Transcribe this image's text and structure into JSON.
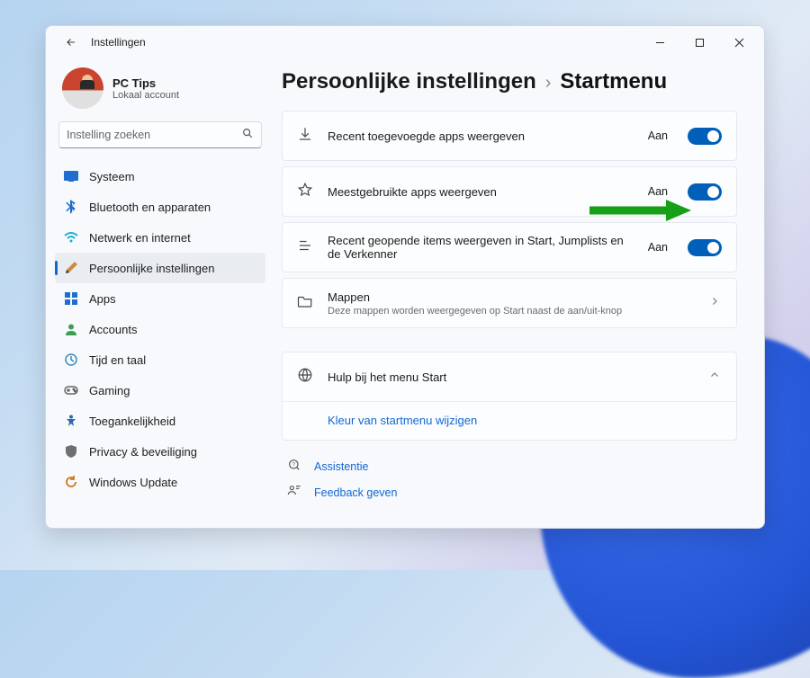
{
  "window": {
    "title": "Instellingen"
  },
  "profile": {
    "name": "PC Tips",
    "sub": "Lokaal account"
  },
  "search": {
    "placeholder": "Instelling zoeken"
  },
  "nav": [
    {
      "key": "systeem",
      "label": "Systeem"
    },
    {
      "key": "bluetooth",
      "label": "Bluetooth en apparaten"
    },
    {
      "key": "netwerk",
      "label": "Netwerk en internet"
    },
    {
      "key": "persoonlijk",
      "label": "Persoonlijke instellingen"
    },
    {
      "key": "apps",
      "label": "Apps"
    },
    {
      "key": "accounts",
      "label": "Accounts"
    },
    {
      "key": "tijd",
      "label": "Tijd en taal"
    },
    {
      "key": "gaming",
      "label": "Gaming"
    },
    {
      "key": "toegankelijkheid",
      "label": "Toegankelijkheid"
    },
    {
      "key": "privacy",
      "label": "Privacy & beveiliging"
    },
    {
      "key": "update",
      "label": "Windows Update"
    }
  ],
  "nav_active": "persoonlijk",
  "breadcrumb": {
    "parent": "Persoonlijke instellingen",
    "current": "Startmenu"
  },
  "toggle_states": {
    "on": "Aan"
  },
  "rows": {
    "recent_apps": {
      "title": "Recent toegevoegde apps weergeven",
      "state": "Aan"
    },
    "most_used": {
      "title": "Meestgebruikte apps weergeven",
      "state": "Aan"
    },
    "recent_items": {
      "title": "Recent geopende items weergeven in Start, Jumplists en de Verkenner",
      "state": "Aan"
    },
    "mappen": {
      "title": "Mappen",
      "sub": "Deze mappen worden weergegeven op Start naast de aan/uit-knop"
    }
  },
  "help": {
    "title": "Hulp bij het menu Start",
    "link": "Kleur van startmenu wijzigen"
  },
  "footer": {
    "assist": "Assistentie",
    "feedback": "Feedback geven"
  },
  "colors": {
    "accent": "#005fb8",
    "link": "#1268d3"
  }
}
